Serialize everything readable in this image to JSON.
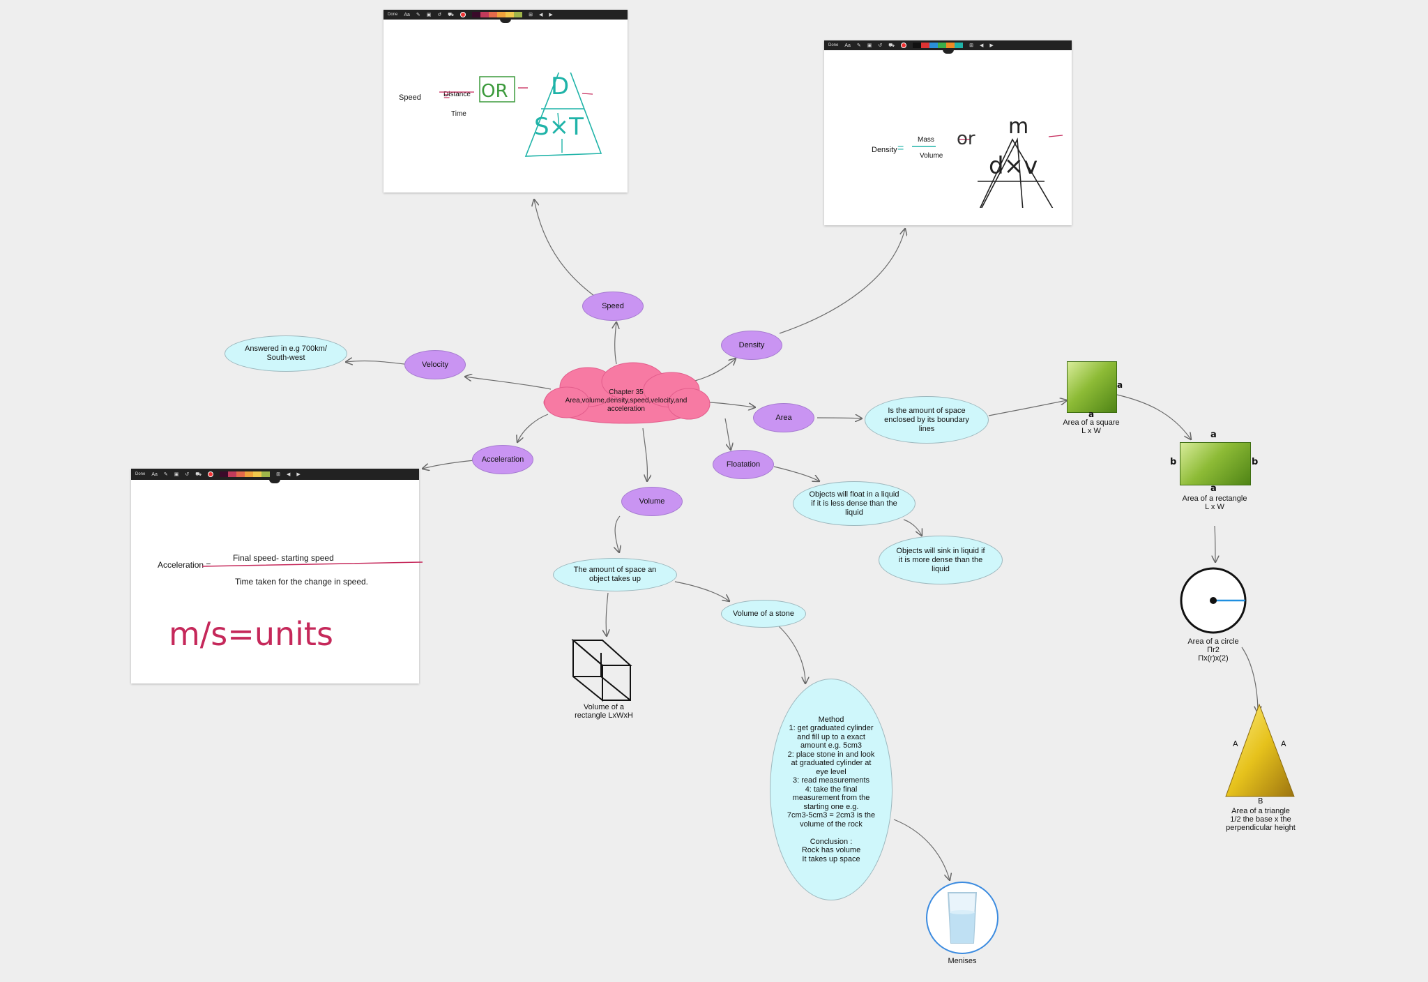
{
  "central": {
    "label": "Chapter 35\nArea,volume,density,speed,velocity,and\nacceleration"
  },
  "topics": {
    "speed": "Speed",
    "density": "Density",
    "velocity": "Velocity",
    "area": "Area",
    "acceleration": "Acceleration",
    "floatation": "Floatation",
    "volume": "Volume"
  },
  "notes": {
    "velocity_answer": "Answered in e.g 700km/\nSouth-west",
    "area_definition": "Is the amount of space\nenclosed by its boundary\nlines",
    "float": "Objects will float in a liquid\nif it is less dense than the\nliquid",
    "sink": "Objects will sink in liquid if\nit is more dense than the\nliquid",
    "volume_definition": "The amount of space an\nobject takes up",
    "volume_stone": "Volume of a stone",
    "method": "Method\n1: get graduated cylinder\nand fill up to a exact\namount e.g. 5cm3\n2: place stone in and look\nat graduated cylinder at\neye level\n3: read measurements\n4: take the final\nmeasurement from the\nstarting one e.g.\n7cm3-5cm3 = 2cm3 is the\nvolume of the rock\n\nConclusion :\nRock has volume\nIt takes up space"
  },
  "captions": {
    "cuboid": "Volume of a\nrectangle LxWxH",
    "glass": "Menises",
    "square": "Area of a square\nL x W",
    "rectangle": "Area of a rectangle\nL x W",
    "circle": "Area of a circle\nΠr2\nΠx(r)x(2)",
    "triangle": "Area of a triangle\n1/2 the base x the\nperpendicular height"
  },
  "shape_labels": {
    "square_side": "a",
    "square_bottom": "a",
    "rect_top": "a",
    "rect_bottom": "a",
    "rect_left": "b",
    "rect_right": "b",
    "tri_left": "A",
    "tri_right": "A",
    "tri_base": "B"
  },
  "toolbar": {
    "done": "Done",
    "font": "Aa"
  },
  "panels": {
    "speed": {
      "label": "Speed",
      "numerator": "Distance",
      "denominator": "Time",
      "or": "OR",
      "tri_top": "D",
      "tri_bottom": "S×T"
    },
    "density": {
      "label": "Density",
      "numerator": "Mass",
      "denominator": "Volume",
      "or": "or",
      "tri_top": "m",
      "tri_bottom": "d×v"
    },
    "acceleration": {
      "label": "Acceleration =",
      "numerator": "Final speed- starting speed",
      "denominator": "Time taken for the change in speed.",
      "units": "m/s=units"
    }
  },
  "colors": {
    "central": "#f77aa3",
    "topic": "#c994f2",
    "note": "#cff7fb",
    "connector": "#666666",
    "teal": "#1fb3a8",
    "ink_red": "#c5285a",
    "ink_green": "#3c9a3c"
  }
}
